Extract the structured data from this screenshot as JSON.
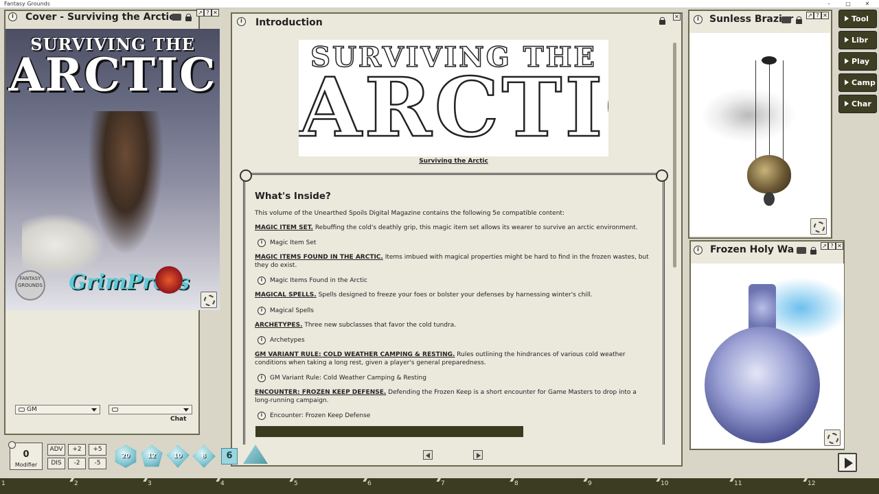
{
  "app": {
    "title": "Fantasy Grounds",
    "controls": [
      "–",
      "□",
      "✕"
    ]
  },
  "cover_panel": {
    "title": "Cover - Surviving the Arctic",
    "art": {
      "title_small": "SURVIVING THE",
      "title_big": "ARCTIC",
      "badge_text": "FANTASY GROUNDS",
      "publisher_logo": "GrimPress"
    }
  },
  "chat": {
    "identity_value": "GM",
    "target_value": "",
    "chat_label": "Chat"
  },
  "intro_panel": {
    "title": "Introduction",
    "logo": {
      "small": "SURVIVING THE",
      "big": "ARCTIC"
    },
    "caption": "Surviving the Arctic",
    "heading": "What's Inside?",
    "intro_text": "This volume of the Unearthed Spoils Digital Magazine contains the following 5e compatible content:",
    "sections": [
      {
        "label": "MAGIC ITEM SET.",
        "text": " Rebuffing the cold's deathly grip, this magic item set allows its wearer to survive an arctic environment.",
        "link": "Magic Item Set"
      },
      {
        "label": "MAGIC ITEMS FOUND IN THE ARCTIC.",
        "text": " Items imbued with magical properties might be hard to find in the frozen wastes, but they do exist.",
        "link": "Magic Items Found in the Arctic"
      },
      {
        "label": "MAGICAL SPELLS.",
        "text": " Spells designed to freeze your foes or bolster your defenses by harnessing winter's chill.",
        "link": "Magical Spells"
      },
      {
        "label": "ARCHETYPES.",
        "text": " Three new subclasses that favor the cold tundra.",
        "link": "Archetypes"
      },
      {
        "label": "GM VARIANT RULE: COLD WEATHER CAMPING & RESTING.",
        "text": " Rules outlining the hindrances of various cold weather conditions when taking a long rest, given a player's general preparedness.",
        "link": "GM Variant Rule: Cold Weather Camping & Resting"
      },
      {
        "label": "ENCOUNTER: FROZEN KEEP DEFENSE.",
        "text": " Defending the Frozen Keep is a short encounter for Game Masters to drop into a long-running campaign.",
        "link": "Encounter: Frozen Keep Defense"
      }
    ]
  },
  "brazier_panel": {
    "title": "Sunless Brazier"
  },
  "water_panel": {
    "title": "Frozen Holy Water"
  },
  "sidebar": {
    "buttons": [
      "Tool",
      "Libr",
      "Play",
      "Camp",
      "Char"
    ]
  },
  "dice_bar": {
    "modifier_value": "0",
    "modifier_label": "Modifier",
    "adv": "ADV",
    "dis": "DIS",
    "plus2": "+2",
    "plus5": "+5",
    "minus2": "-2",
    "minus5": "-5",
    "dice": [
      "20",
      "12",
      "10",
      "8",
      "6"
    ]
  },
  "hotkey_tray": [
    "1",
    "2",
    "3",
    "4",
    "5",
    "6",
    "7",
    "8",
    "9",
    "10",
    "11",
    "12"
  ],
  "icons": {
    "info": "info-icon",
    "lock": "lock-icon",
    "share": "share-icon",
    "gear": "gear-icon",
    "close": "close-icon",
    "play": "play-icon"
  },
  "colors": {
    "panel_bg": "#ebe8dc",
    "frame": "#6b6a52",
    "sidebar_button": "#3e3e24",
    "tray": "#3c3c22",
    "dice": "#86c9d3"
  }
}
